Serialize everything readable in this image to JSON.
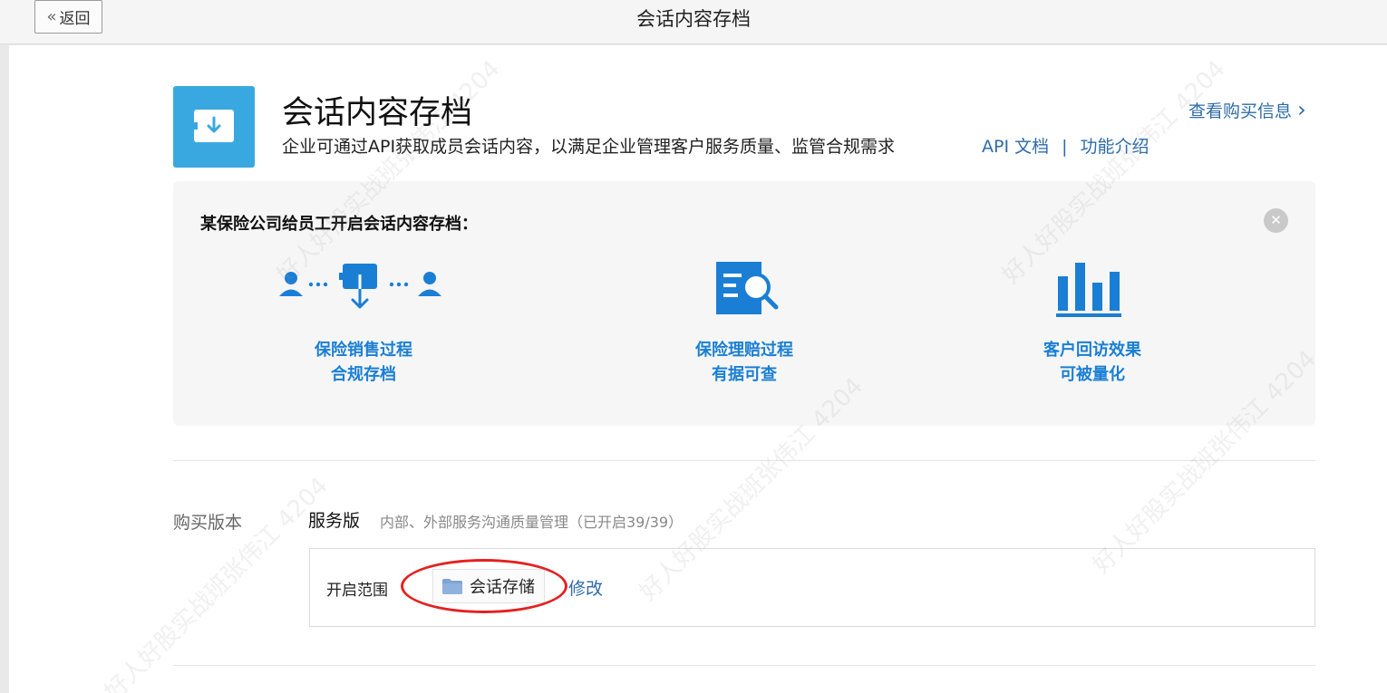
{
  "topbar": {
    "back_label": "返回",
    "title": "会话内容存档"
  },
  "hero": {
    "title": "会话内容存档",
    "description": "企业可通过API获取成员会话内容，以满足企业管理客户服务质量、监管合规需求",
    "api_doc_link": "API 文档",
    "link_separator": "|",
    "intro_link": "功能介绍",
    "purchase_link": "查看购买信息",
    "purchase_chevron": "›"
  },
  "case": {
    "title": "某保险公司给员工开启会话内容存档：",
    "close_glyph": "✕",
    "features": [
      {
        "line1": "保险销售过程",
        "line2": "合规存档",
        "icon": "users-archive-icon"
      },
      {
        "line1": "保险理赔过程",
        "line2": "有据可查",
        "icon": "document-search-icon"
      },
      {
        "line1": "客户回访效果",
        "line2": "可被量化",
        "icon": "bar-chart-icon"
      }
    ]
  },
  "version": {
    "label": "购买版本",
    "name": "服务版",
    "description": "内部、外部服务沟通质量管理（已开启39/39）"
  },
  "scope": {
    "label": "开启范围",
    "tag": "会话存储",
    "tag_icon": "folder-icon",
    "modify_link": "修改"
  },
  "colors": {
    "accent_blue": "#1a7fd4",
    "link_blue": "#2e6ba8",
    "hero_icon_bg": "#3aa8e0",
    "annotation_red": "#e52020"
  },
  "watermark": "好人好股实战班张伟江 4204"
}
